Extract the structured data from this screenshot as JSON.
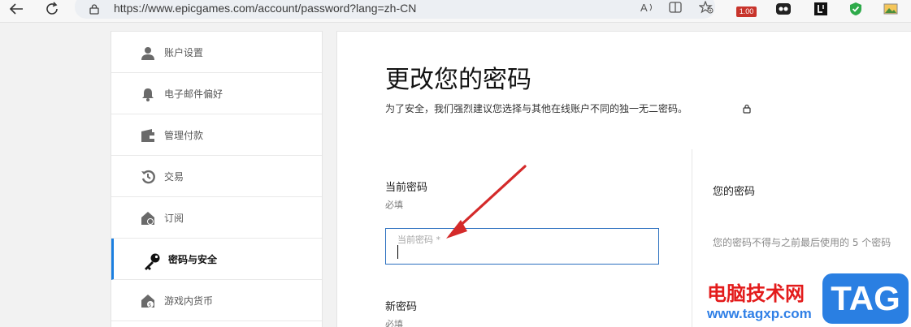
{
  "browser": {
    "url": "https://www.epicgames.com/account/password?lang=zh-CN",
    "extension_badge": "1.00"
  },
  "sidebar": {
    "items": [
      {
        "label": "账户设置",
        "icon": "user-icon",
        "active": false
      },
      {
        "label": "电子邮件偏好",
        "icon": "bell-icon",
        "active": false
      },
      {
        "label": "管理付款",
        "icon": "wallet-icon",
        "active": false
      },
      {
        "label": "交易",
        "icon": "history-icon",
        "active": false
      },
      {
        "label": "订阅",
        "icon": "subscription-icon",
        "active": false
      },
      {
        "label": "密码与安全",
        "icon": "key-icon",
        "active": true
      },
      {
        "label": "游戏内货币",
        "icon": "currency-icon",
        "active": false
      }
    ]
  },
  "main": {
    "title": "更改您的密码",
    "subtitle": "为了安全，我们强烈建议您选择与其他在线账户不同的独一无二密码。",
    "current_password": {
      "label": "当前密码",
      "required": "必填",
      "placeholder": "当前密码 *"
    },
    "new_password": {
      "label": "新密码",
      "required": "必填"
    },
    "right_panel": {
      "heading": "您的密码",
      "text": "您的密码不得与之前最后使用的 5 个密码"
    }
  },
  "watermark": {
    "site_name": "电脑技术网",
    "url": "www.tagxp.com",
    "tag": "TAG"
  },
  "colors": {
    "accent": "#1b7fe0",
    "input_border": "#2a6fbf",
    "annotation_arrow": "#d42a2a"
  }
}
